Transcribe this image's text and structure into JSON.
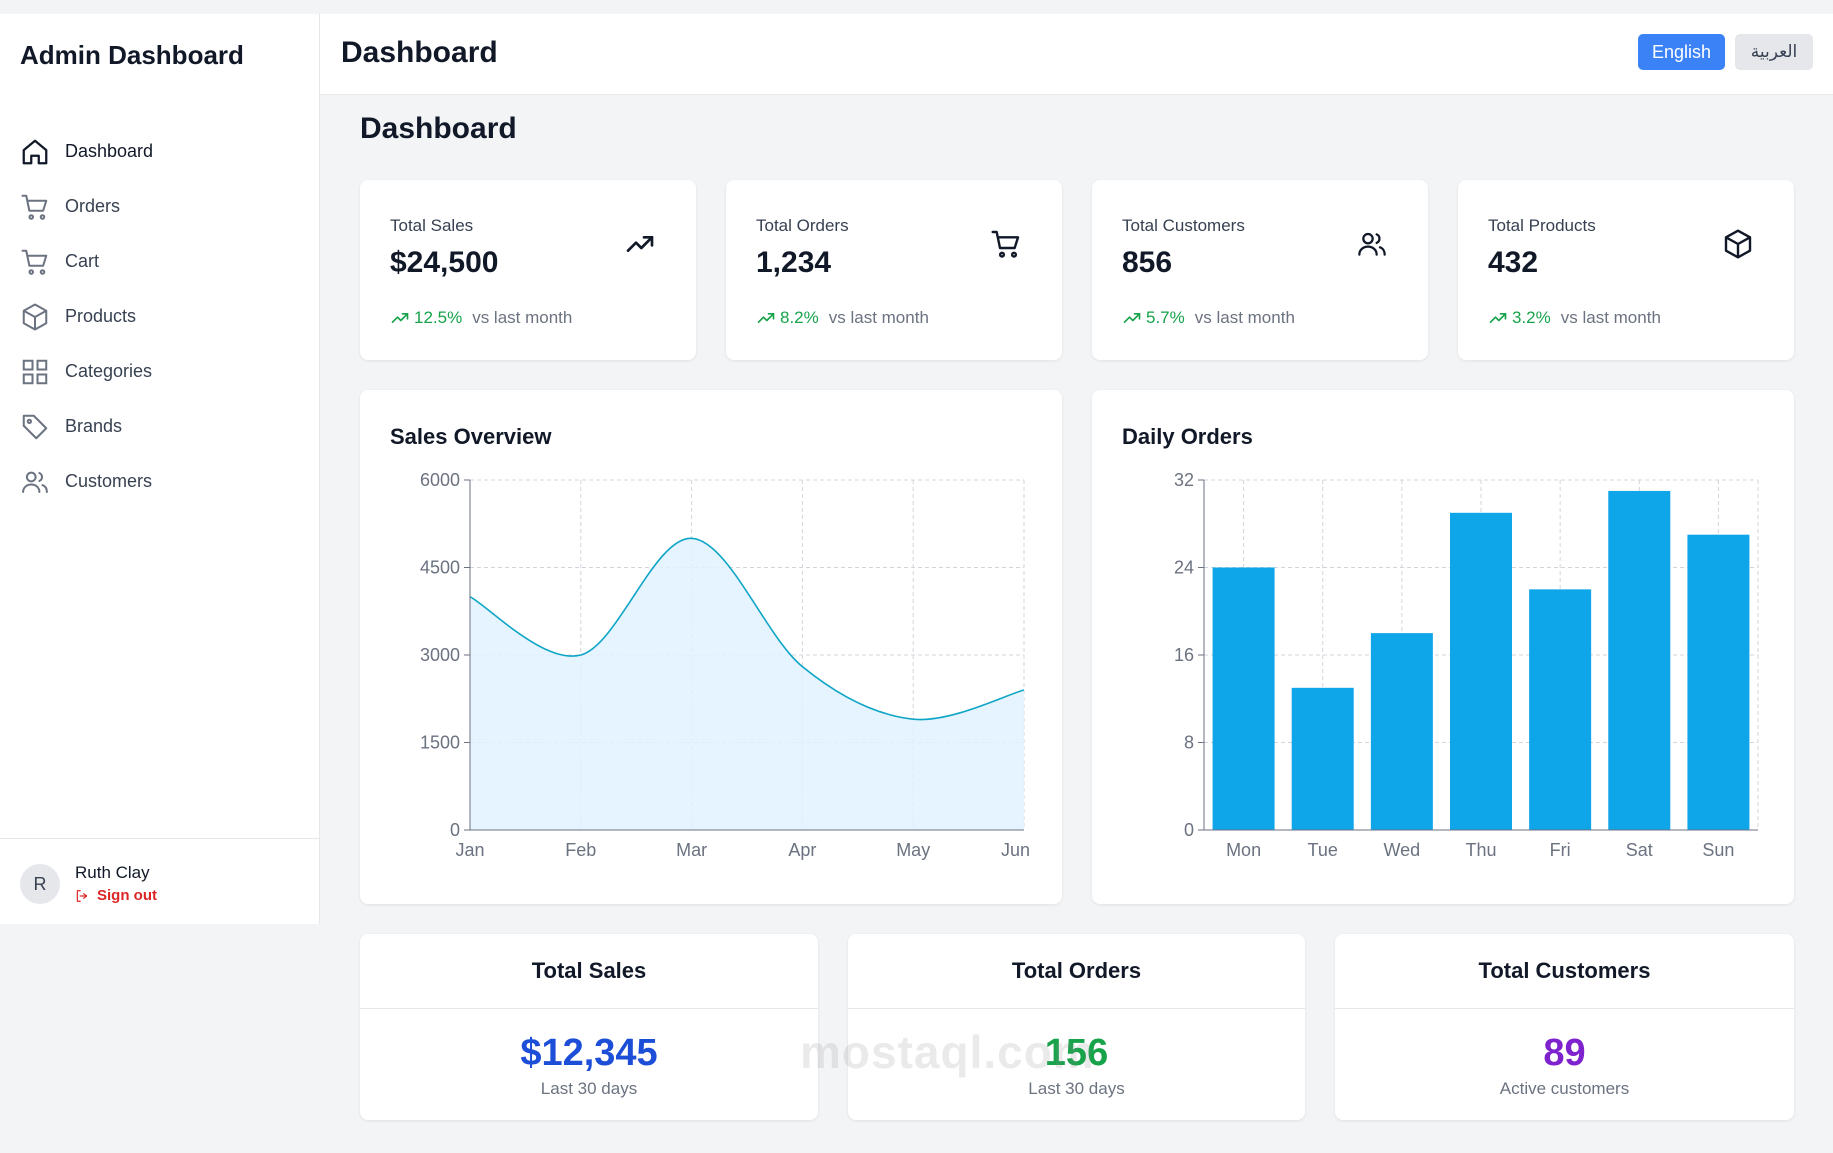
{
  "brand": "Admin Dashboard",
  "header": {
    "title": "Dashboard",
    "lang_en": "English",
    "lang_ar": "العربية"
  },
  "main": {
    "title": "Dashboard"
  },
  "sidebar": {
    "items": [
      {
        "label": "Dashboard",
        "icon": "home-icon"
      },
      {
        "label": "Orders",
        "icon": "cart-icon"
      },
      {
        "label": "Cart",
        "icon": "cart-icon"
      },
      {
        "label": "Products",
        "icon": "box-icon"
      },
      {
        "label": "Categories",
        "icon": "grid-icon"
      },
      {
        "label": "Brands",
        "icon": "tag-icon"
      },
      {
        "label": "Customers",
        "icon": "users-icon"
      }
    ]
  },
  "user": {
    "initial": "R",
    "name": "Ruth Clay",
    "signout": "Sign out"
  },
  "stats": [
    {
      "label": "Total Sales",
      "value": "$24,500",
      "change": "12.5%",
      "vs": "vs last month",
      "icon": "trending-up-icon"
    },
    {
      "label": "Total Orders",
      "value": "1,234",
      "change": "8.2%",
      "vs": "vs last month",
      "icon": "cart-icon"
    },
    {
      "label": "Total Customers",
      "value": "856",
      "change": "5.7%",
      "vs": "vs last month",
      "icon": "users-icon"
    },
    {
      "label": "Total Products",
      "value": "432",
      "change": "3.2%",
      "vs": "vs last month",
      "icon": "box-icon"
    }
  ],
  "colors": {
    "accent": "#3b82f6",
    "positive": "#16a34a",
    "line": "#0ea5c6",
    "bar": "#0ea5e9"
  },
  "chart_data": [
    {
      "type": "area",
      "title": "Sales Overview",
      "categories": [
        "Jan",
        "Feb",
        "Mar",
        "Apr",
        "May",
        "Jun"
      ],
      "values": [
        4000,
        3000,
        5000,
        2800,
        1900,
        2400
      ],
      "ylim": [
        0,
        6000
      ],
      "yticks": [
        0,
        1500,
        3000,
        4500,
        6000
      ],
      "grid": true
    },
    {
      "type": "bar",
      "title": "Daily Orders",
      "categories": [
        "Mon",
        "Tue",
        "Wed",
        "Thu",
        "Fri",
        "Sat",
        "Sun"
      ],
      "values": [
        24,
        13,
        18,
        29,
        22,
        31,
        27
      ],
      "ylim": [
        0,
        32
      ],
      "yticks": [
        0,
        8,
        16,
        24,
        32
      ],
      "grid": true
    }
  ],
  "summary": [
    {
      "title": "Total Sales",
      "value": "$12,345",
      "sub": "Last 30 days",
      "color": "#1d4ed8"
    },
    {
      "title": "Total Orders",
      "value": "156",
      "sub": "Last 30 days",
      "color": "#16a34a"
    },
    {
      "title": "Total Customers",
      "value": "89",
      "sub": "Active customers",
      "color": "#7e22ce"
    }
  ],
  "watermark": "mostaql.com"
}
